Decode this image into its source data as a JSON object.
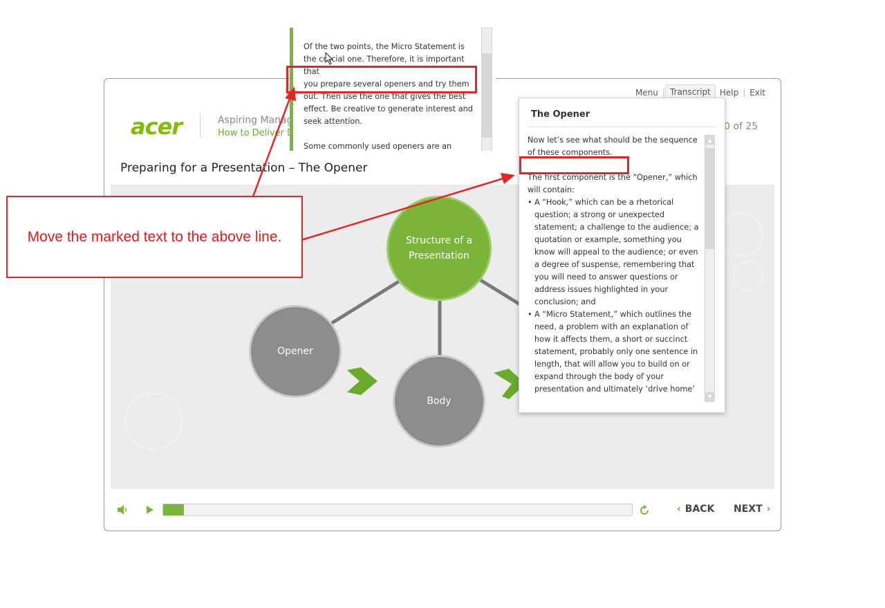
{
  "menu": {
    "items": [
      "Menu",
      "Transcript",
      "Help",
      "Exit"
    ],
    "active": "Transcript"
  },
  "header": {
    "logo": "acer",
    "course_title": "Aspiring Manag",
    "course_subtitle": "How to Deliver D",
    "page_current_fragment": "0",
    "page_total_text": " of 25"
  },
  "slide": {
    "title": "Preparing for a Presentation – The Opener",
    "hub_label": "Structure of a Presentation",
    "opener_label": "Opener",
    "body_label": "Body"
  },
  "transcript": {
    "title": "The Opener",
    "line1": "Now let’s see what should be the sequence",
    "line2": "of these components.",
    "para2": "The first component is the “Opener,” which will contain:",
    "bullet1": "A “Hook,” which can be a rhetorical question; a strong or unexpected statement; a challenge to the audience; a quotation or example, something you know will appeal to the audience; or even a degree of suspense, remembering that you will need to answer questions or address issues highlighted in your conclusion; and",
    "bullet2": "A “Micro Statement,” which outlines the need, a problem with an explanation of how it affects them, a short or succinct statement, probably only one sentence in length, that will allow you to build on or expand through the body of your presentation and ultimately ‘drive home’"
  },
  "popup": {
    "line1": "Of the two points, the Micro Statement is the crucial one. Therefore, it is important that",
    "line2": "you prepare several openers and try them out. Then use the one that gives the best effect. Be creative to generate interest and seek attention.",
    "line3": "Some commonly used openers are an"
  },
  "controls": {
    "back_label": "BACK",
    "next_label": "NEXT",
    "progress_fraction": 0.044
  },
  "annotation": {
    "note": "Move the marked text to the above line.",
    "color": "#e52525"
  },
  "colors": {
    "accent": "#7bb63c",
    "hub": "#7ab43a",
    "node": "#8c8c8c",
    "arrow": "#6aab2e"
  }
}
